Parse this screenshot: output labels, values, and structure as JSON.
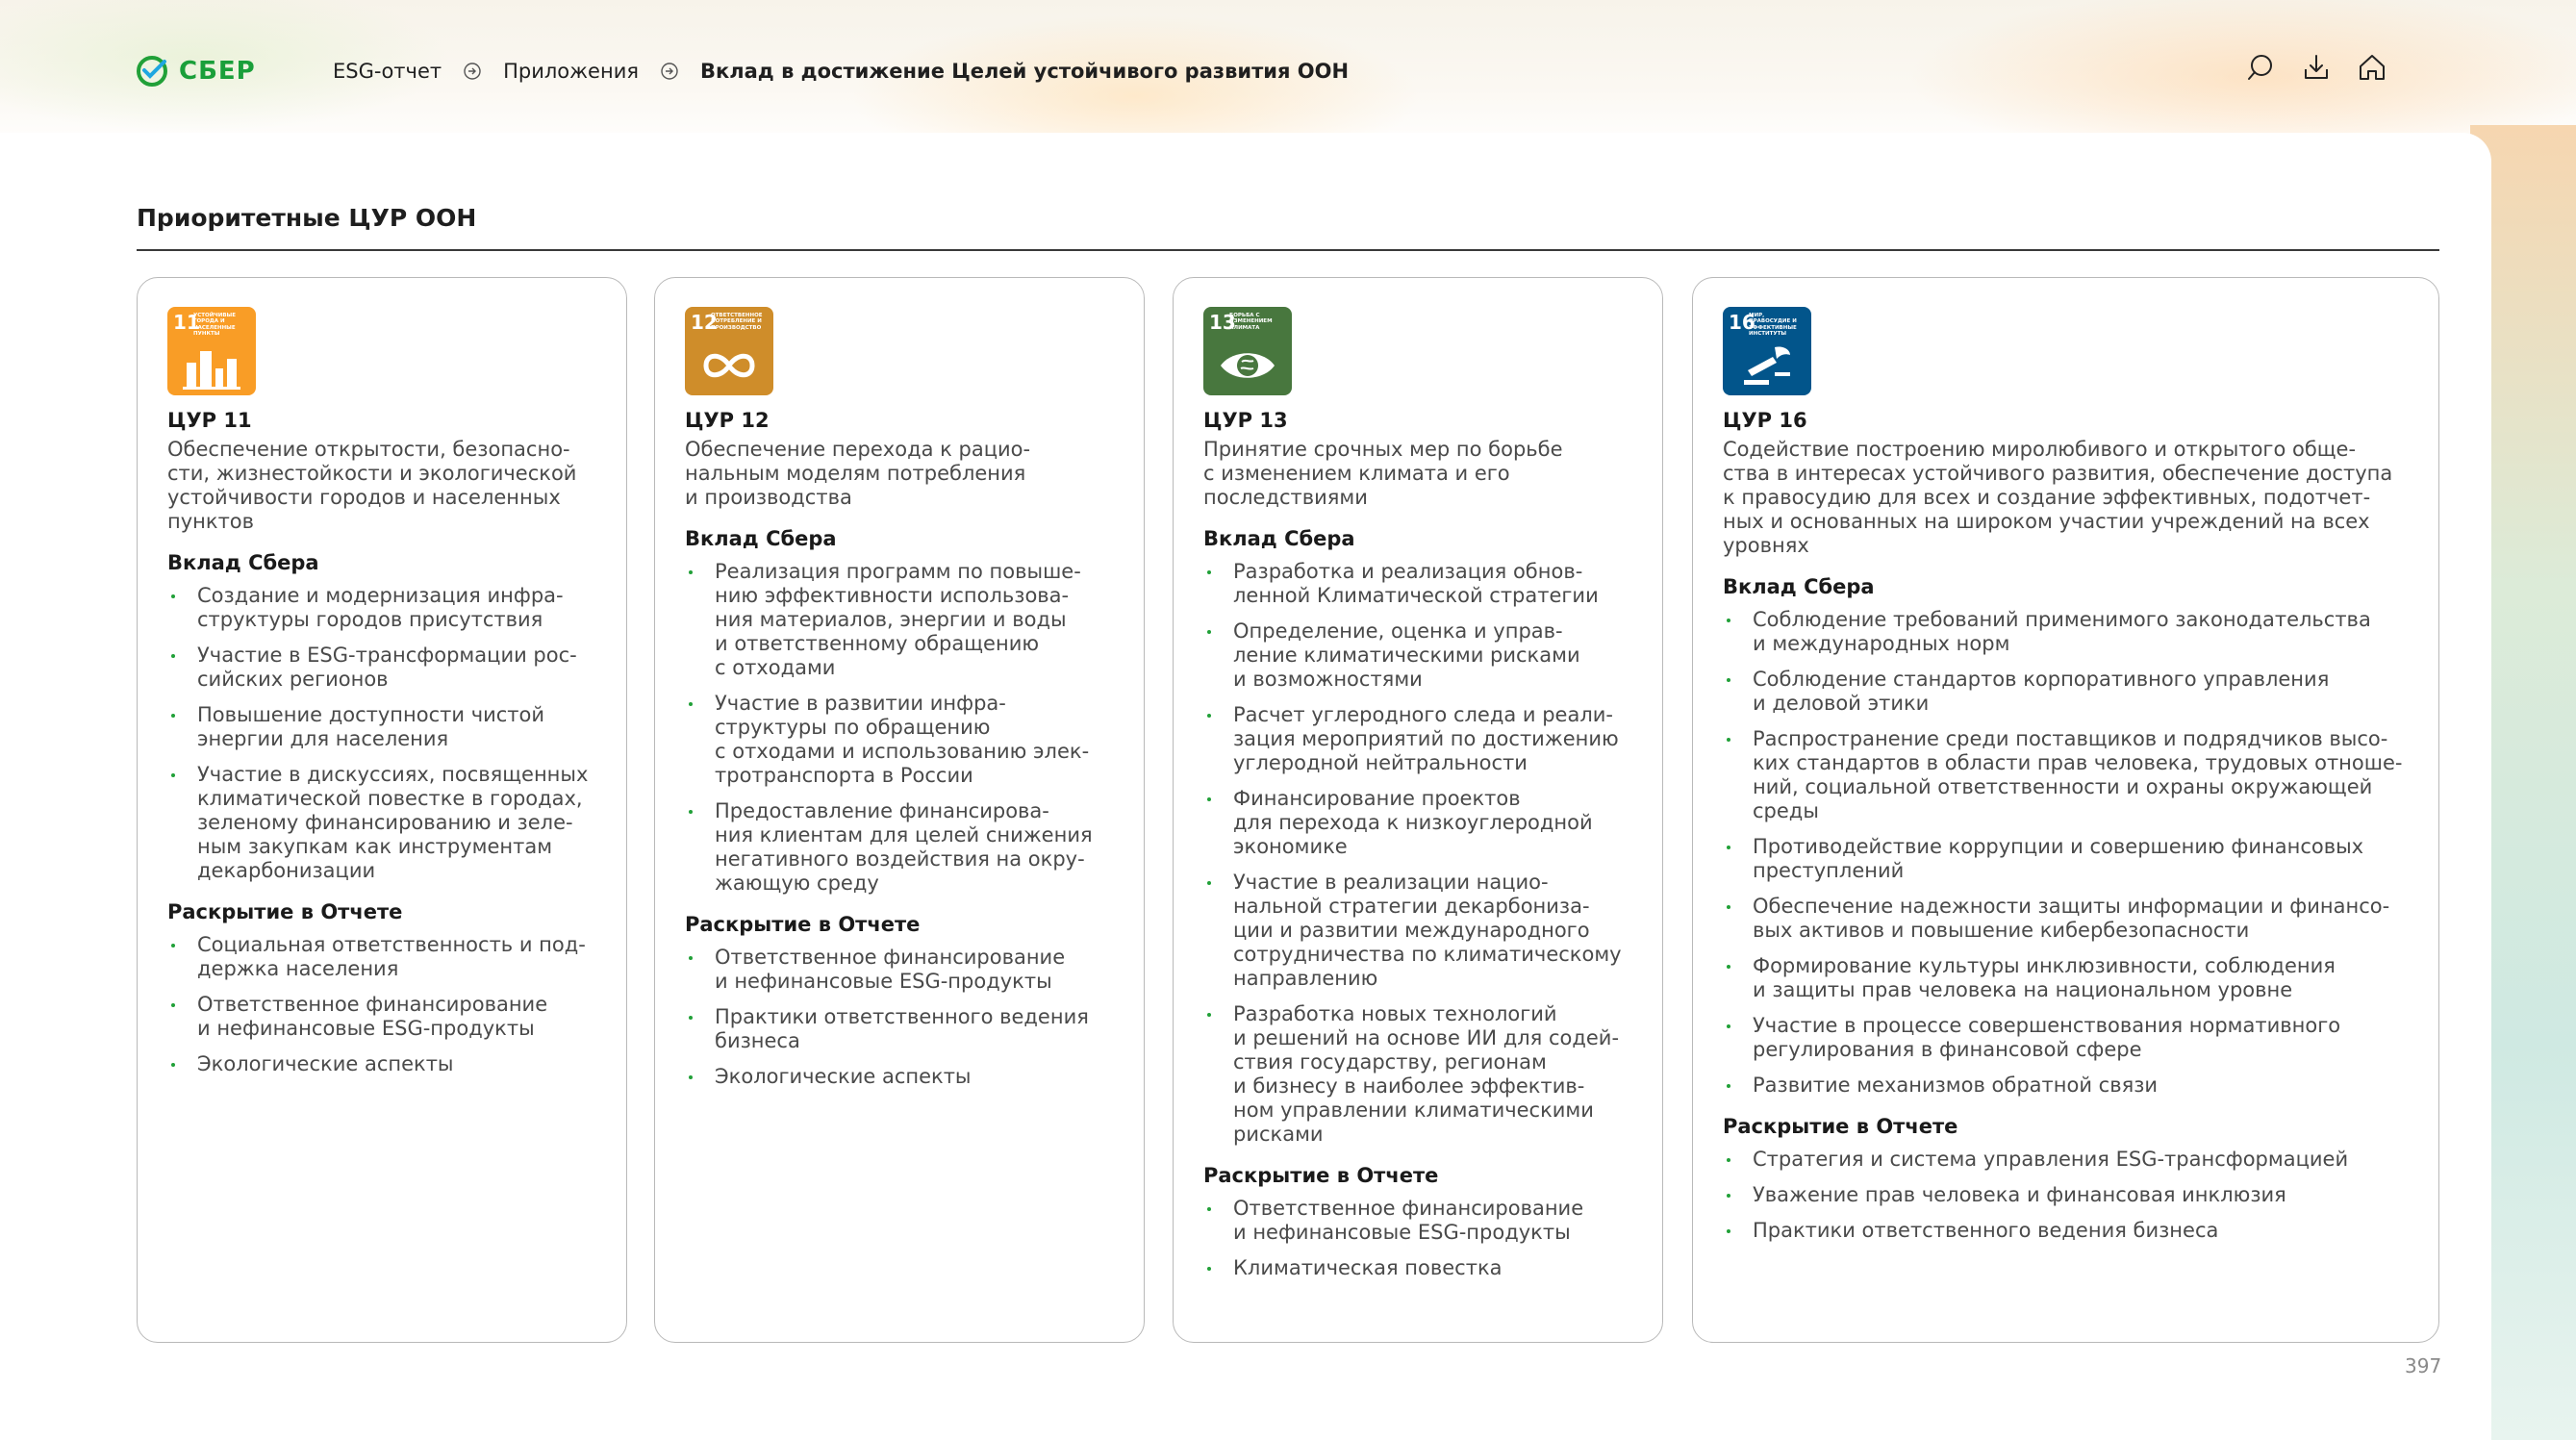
{
  "brand": {
    "name": "СБЕР",
    "color": "#21A038"
  },
  "breadcrumb": [
    "ESG-отчет",
    "Приложения",
    "Вклад в достижение Целей устойчивого развития ООН"
  ],
  "header_icons": [
    "search-icon",
    "download-icon",
    "home-icon"
  ],
  "section_title": "Приоритетные ЦУР ООН",
  "cards": [
    {
      "badge": {
        "number": "11",
        "caption": "Устойчивые города и населенные пункты",
        "color": "#F99D26",
        "icon": "city-icon"
      },
      "title": "ЦУР 11",
      "description": "Обеспечение открытости, безопасно-\nсти, жизнестойкости и экологической\nустойчивости городов и населенных\nпунктов",
      "contrib_heading": "Вклад Сбера",
      "contrib": [
        "Создание и модернизация инфра-\nструктуры городов присутствия",
        "Участие в ESG-трансформации рос-\nсийских регионов",
        "Повышение доступности чистой\nэнергии для населения",
        "Участие в дискуссиях, посвященных\nклиматической повестке в городах,\nзеленому финансированию и зеле-\nным закупкам как инструментам\nдекарбонизации"
      ],
      "disclosure_heading": "Раскрытие в Отчете",
      "disclosure": [
        "Социальная ответственность и под-\nдержка населения",
        "Ответственное финансирование\nи нефинансовые ESG-продукты",
        "Экологические аспекты"
      ]
    },
    {
      "badge": {
        "number": "12",
        "caption": "Ответственное потребление и производство",
        "color": "#CF8D2A",
        "icon": "infinity-icon"
      },
      "title": "ЦУР 12",
      "description": "Обеспечение перехода к рацио-\nнальным моделям потребления\nи производства",
      "contrib_heading": "Вклад Сбера",
      "contrib": [
        "Реализация программ по повыше-\nнию эффективности использова-\nния материалов, энергии и воды\nи ответственному обращению\nс отходами",
        "Участие в развитии инфра-\nструктуры по обращению\nс отходами и использованию элек-\nтротранспорта в России",
        "Предоставление финансирова-\nния клиентам для целей снижения\nнегативного воздействия на окру-\nжающую среду"
      ],
      "disclosure_heading": "Раскрытие в Отчете",
      "disclosure": [
        "Ответственное финансирование\nи нефинансовые ESG-продукты",
        "Практики ответственного ведения\nбизнеса",
        "Экологические аспекты"
      ]
    },
    {
      "badge": {
        "number": "13",
        "caption": "Борьба с изменением климата",
        "color": "#48773E",
        "icon": "eye-globe-icon"
      },
      "title": "ЦУР 13",
      "description": "Принятие срочных мер по борьбе\nс изменением климата и его\nпоследствиями",
      "contrib_heading": "Вклад Сбера",
      "contrib": [
        "Разработка и реализация обнов-\nленной Климатической стратегии",
        "Определение, оценка и управ-\nление климатическими рисками\nи возможностями",
        "Расчет углеродного следа и реали-\nзация мероприятий по достижению\nуглеродной нейтральности",
        "Финансирование проектов\nдля перехода к низкоуглеродной\nэкономике",
        "Участие в реализации нацио-\nнальной стратегии декарбониза-\nции и развитии международного\nсотрудничества по климатическому\nнаправлению",
        "Разработка новых технологий\nи решений на основе ИИ для содей-\nствия государству, регионам\nи бизнесу в наиболее эффектив-\nном управлении климатическими\nрисками"
      ],
      "disclosure_heading": "Раскрытие в Отчете",
      "disclosure": [
        "Ответственное финансирование\nи нефинансовые ESG-продукты",
        "Климатическая повестка"
      ]
    },
    {
      "badge": {
        "number": "16",
        "caption": "Мир, правосудие и эффективные институты",
        "color": "#02558B",
        "icon": "dove-gavel-icon"
      },
      "title": "ЦУР 16",
      "description": "Содействие построению миролюбивого и открытого обще-\nства в интересах устойчивого развития, обеспечение доступа\nк правосудию для всех и создание эффективных, подотчет-\nных и основанных на широком участии учреждений на всех\nуровнях",
      "contrib_heading": "Вклад Сбера",
      "contrib": [
        "Соблюдение требований применимого законодательства\nи международных норм",
        "Соблюдение стандартов корпоративного управления\nи деловой этики",
        "Распространение среди поставщиков и подрядчиков высо-\nких стандартов в области прав человека, трудовых отноше-\nний, социальной ответственности и охраны окружающей\nсреды",
        "Противодействие коррупции и совершению финансовых\nпреступлений",
        "Обеспечение надежности защиты информации и финансо-\nвых активов и повышение кибербезопасности",
        "Формирование культуры инклюзивности, соблюдения\nи защиты прав человека на национальном уровне",
        "Участие в процессе совершенствования нормативного\nрегулирования в финансовой сфере",
        "Развитие механизмов обратной связи"
      ],
      "disclosure_heading": "Раскрытие в Отчете",
      "disclosure": [
        "Стратегия и система управления ESG-трансформацией",
        "Уважение прав человека и финансовая инклюзия",
        "Практики ответственного ведения бизнеса"
      ]
    }
  ],
  "page_number": "397"
}
